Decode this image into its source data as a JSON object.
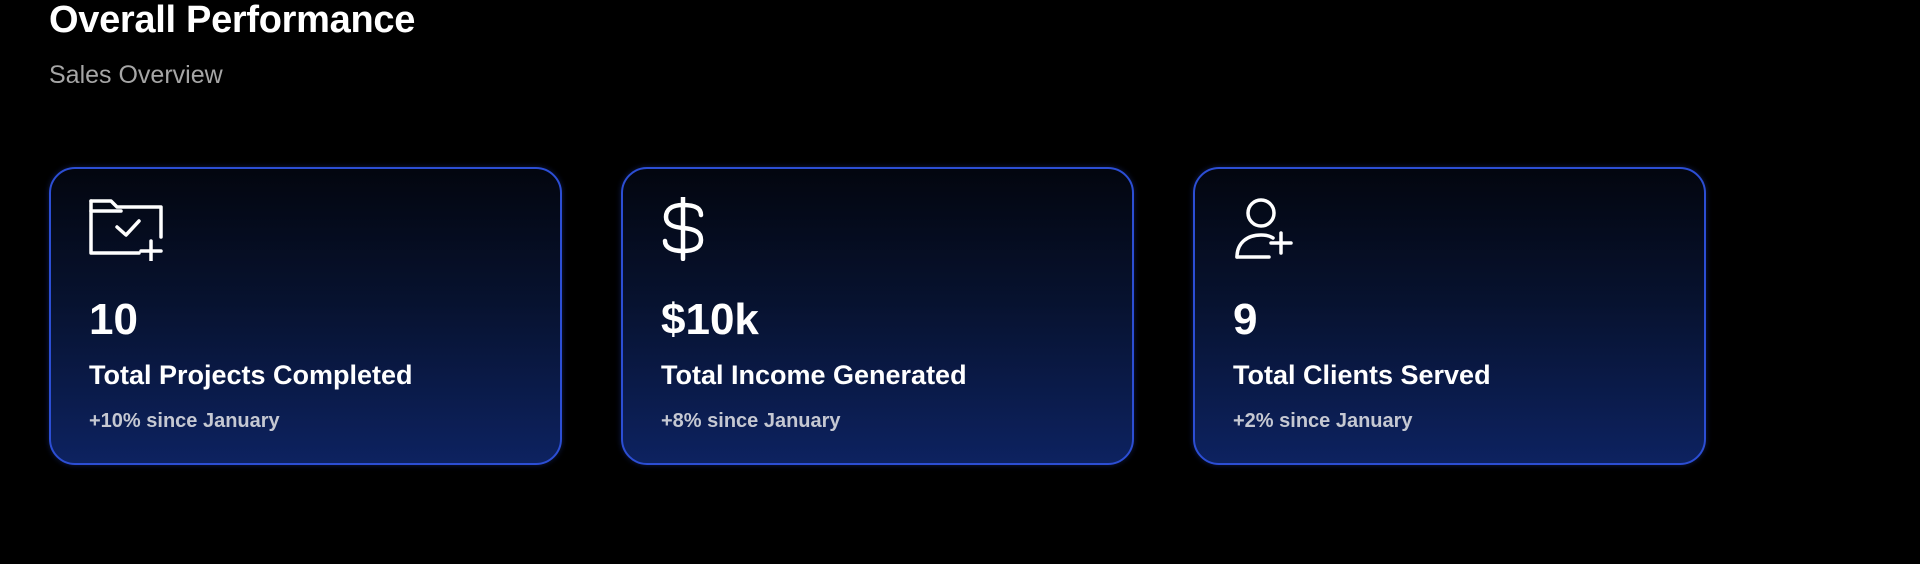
{
  "header": {
    "title": "Overall Performance",
    "subtitle": "Sales Overview"
  },
  "cards": [
    {
      "icon": "folder-check-plus-icon",
      "value": "10",
      "label": "Total Projects Completed",
      "change": "+10% since January"
    },
    {
      "icon": "dollar-icon",
      "value": "$10k",
      "label": "Total Income Generated",
      "change": "+8% since January"
    },
    {
      "icon": "user-plus-icon",
      "value": "9",
      "label": "Total Clients Served",
      "change": "+2% since January"
    }
  ],
  "colors": {
    "background": "#000000",
    "card_border": "#2c4ed4",
    "card_gradient_top": "#03060f",
    "card_gradient_bottom": "#0d2260",
    "text_primary": "#ffffff",
    "text_muted": "#a6a6a6"
  }
}
